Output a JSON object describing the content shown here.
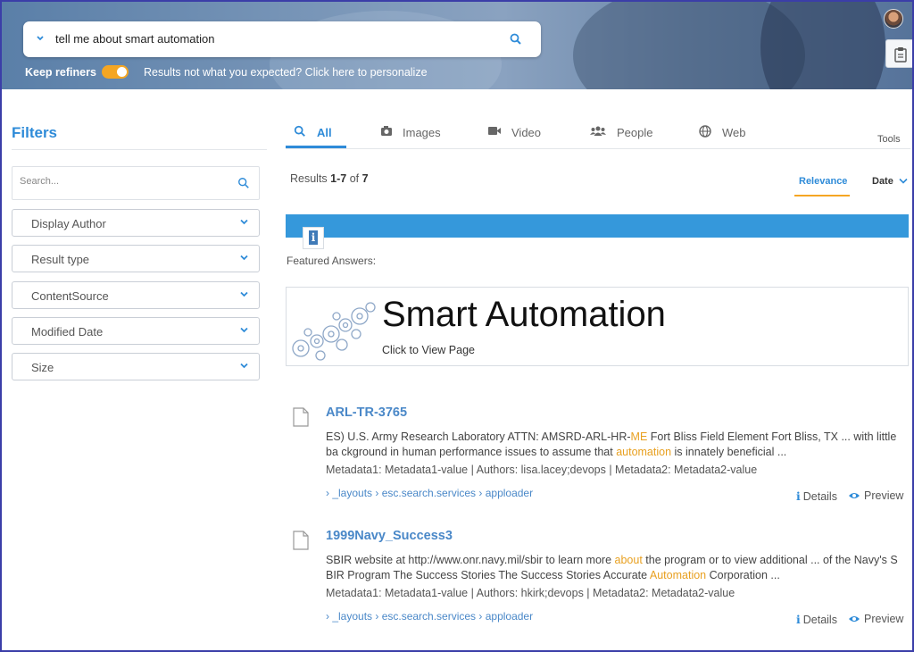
{
  "header": {
    "query": "tell me about smart automation",
    "keep_refiners_label": "Keep refiners",
    "keep_refiners_on": true,
    "personalize_text": "Results not what you expected? Click here to personalize"
  },
  "sidebar": {
    "title": "Filters",
    "search_placeholder": "Search...",
    "facets": [
      "Display Author",
      "Result type",
      "ContentSource",
      "Modified Date",
      "Size"
    ]
  },
  "tabs": [
    {
      "label": "All",
      "icon": "search-icon",
      "active": true
    },
    {
      "label": "Images",
      "icon": "camera-icon"
    },
    {
      "label": "Video",
      "icon": "video-camera-icon"
    },
    {
      "label": "People",
      "icon": "people-icon"
    },
    {
      "label": "Web",
      "icon": "globe-icon"
    }
  ],
  "tools_label": "Tools",
  "results_summary": {
    "prefix": "Results ",
    "range": "1-7",
    "of": " of ",
    "total": "7"
  },
  "sort": {
    "relevance": "Relevance",
    "date": "Date"
  },
  "featured": {
    "label": "Featured Answers:",
    "title": "Smart Automation",
    "subtitle": "Click to View Page"
  },
  "results": [
    {
      "title": "ARL-TR-3765",
      "snippet_parts": [
        {
          "t": "ES) U.S. Army Research Laboratory ATTN: AMSRD-ARL-HR-",
          "h": false
        },
        {
          "t": "ME",
          "h": true
        },
        {
          "t": " Fort Bliss Field Element Fort Bliss, TX ... with little ba ckground in human performance issues to assume that ",
          "h": false
        },
        {
          "t": "automation",
          "h": true
        },
        {
          "t": " is innately beneficial ...",
          "h": false
        }
      ],
      "meta": "Metadata1: Metadata1-value | Authors: lisa.lacey;devops | Metadata2: Metadata2-value",
      "crumbs": "› _layouts › esc.search.services › apploader",
      "details": "Details",
      "preview": "Preview"
    },
    {
      "title": "1999Navy_Success3",
      "snippet_parts": [
        {
          "t": "SBIR website at http://www.onr.navy.mil/sbir to learn more ",
          "h": false
        },
        {
          "t": "about",
          "h": true
        },
        {
          "t": " the program or to view additional ... of the Navy's S BIR Program The Success Stories The Success Stories Accurate ",
          "h": false
        },
        {
          "t": "Automation",
          "h": true
        },
        {
          "t": " Corporation ...",
          "h": false
        }
      ],
      "meta": "Metadata1: Metadata1-value | Authors: hkirk;devops | Metadata2: Metadata2-value",
      "crumbs": "› _layouts › esc.search.services › apploader",
      "details": "Details",
      "preview": "Preview"
    }
  ],
  "colors": {
    "accent": "#2e8bd8",
    "highlight": "#e8a020",
    "toggle": "#f5a623",
    "banner_bar": "#3598db"
  }
}
